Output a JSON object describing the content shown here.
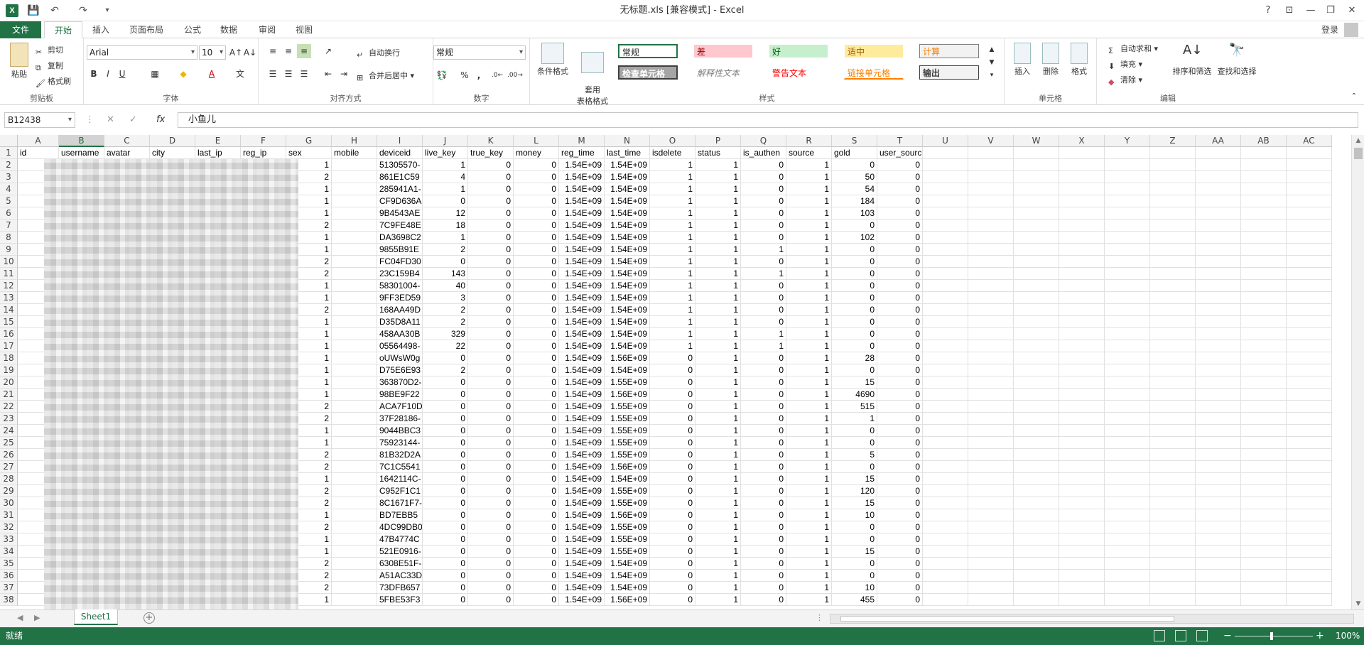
{
  "titlebar": {
    "title": "无标题.xls [兼容模式] - Excel",
    "app_icon": "X",
    "undo": "↶",
    "redo": "↷",
    "save": "💾",
    "help": "?",
    "minimize": "—",
    "restore": "❐",
    "close": "✕",
    "ribbon_toggle": "⊡"
  },
  "tabs": {
    "file": "文件",
    "items": [
      "开始",
      "插入",
      "页面布局",
      "公式",
      "数据",
      "审阅",
      "视图"
    ],
    "login": "登录"
  },
  "ribbon": {
    "clipboard": {
      "label": "剪贴板",
      "paste": "粘贴",
      "cut": "剪切",
      "copy": "复制",
      "format_painter": "格式刷"
    },
    "font": {
      "label": "字体",
      "font_name": "Arial",
      "font_size": "10",
      "bold": "B",
      "italic": "I",
      "underline": "U"
    },
    "alignment": {
      "label": "对齐方式",
      "wrap": "自动换行",
      "merge": "合并后居中"
    },
    "number": {
      "label": "数字",
      "format": "常规",
      "percent": "%",
      "comma": ","
    },
    "styles": {
      "label": "样式",
      "conditional": "条件格式",
      "table": "套用\n表格格式",
      "cells": [
        "常规",
        "差",
        "好",
        "适中",
        "计算",
        "检查单元格",
        "解释性文本",
        "警告文本",
        "链接单元格",
        "输出"
      ]
    },
    "cells": {
      "label": "单元格",
      "insert": "插入",
      "delete": "删除",
      "format": "格式"
    },
    "editing": {
      "label": "编辑",
      "autosum": "自动求和",
      "fill": "填充",
      "clear": "清除",
      "sort": "排序和筛选",
      "find": "查找和选择"
    }
  },
  "formula_bar": {
    "name_box": "B12438",
    "fx": "fx",
    "cancel": "✕",
    "enter": "✓",
    "content": "小鱼儿"
  },
  "columns": [
    "A",
    "B",
    "C",
    "D",
    "E",
    "F",
    "G",
    "H",
    "I",
    "J",
    "K",
    "L",
    "M",
    "N",
    "O",
    "P",
    "Q",
    "R",
    "S",
    "T",
    "U",
    "V",
    "W",
    "X",
    "Y",
    "Z",
    "AA",
    "AB",
    "AC"
  ],
  "header_row": [
    "id",
    "username",
    "avatar",
    "city",
    "last_ip",
    "reg_ip",
    "sex",
    "mobile",
    "deviceid",
    "live_key",
    "true_key",
    "money",
    "reg_time",
    "last_time",
    "isdelete",
    "status",
    "is_authen",
    "source",
    "gold",
    "user_source"
  ],
  "rows": [
    {
      "r": "2",
      "sex": "1",
      "dev": "51305570-",
      "lk": "1",
      "tk": "0",
      "mo": "0",
      "rt": "1.54E+09",
      "lt": "1.54E+09",
      "del": "1",
      "st": "1",
      "au": "0",
      "src": "1",
      "gold": "0",
      "us": "0"
    },
    {
      "r": "3",
      "sex": "2",
      "dev": "861E1C59",
      "lk": "4",
      "tk": "0",
      "mo": "0",
      "rt": "1.54E+09",
      "lt": "1.54E+09",
      "del": "1",
      "st": "1",
      "au": "0",
      "src": "1",
      "gold": "50",
      "us": "0"
    },
    {
      "r": "4",
      "sex": "1",
      "dev": "285941A1-",
      "lk": "1",
      "tk": "0",
      "mo": "0",
      "rt": "1.54E+09",
      "lt": "1.54E+09",
      "del": "1",
      "st": "1",
      "au": "0",
      "src": "1",
      "gold": "54",
      "us": "0"
    },
    {
      "r": "5",
      "sex": "1",
      "dev": "CF9D636A",
      "lk": "0",
      "tk": "0",
      "mo": "0",
      "rt": "1.54E+09",
      "lt": "1.54E+09",
      "del": "1",
      "st": "1",
      "au": "0",
      "src": "1",
      "gold": "184",
      "us": "0"
    },
    {
      "r": "6",
      "sex": "1",
      "dev": "9B4543AE",
      "lk": "12",
      "tk": "0",
      "mo": "0",
      "rt": "1.54E+09",
      "lt": "1.54E+09",
      "del": "1",
      "st": "1",
      "au": "0",
      "src": "1",
      "gold": "103",
      "us": "0"
    },
    {
      "r": "7",
      "sex": "2",
      "dev": "7C9FE48E",
      "lk": "18",
      "tk": "0",
      "mo": "0",
      "rt": "1.54E+09",
      "lt": "1.54E+09",
      "del": "1",
      "st": "1",
      "au": "0",
      "src": "1",
      "gold": "0",
      "us": "0"
    },
    {
      "r": "8",
      "sex": "1",
      "dev": "DA3698C2",
      "lk": "1",
      "tk": "0",
      "mo": "0",
      "rt": "1.54E+09",
      "lt": "1.54E+09",
      "del": "1",
      "st": "1",
      "au": "0",
      "src": "1",
      "gold": "102",
      "us": "0"
    },
    {
      "r": "9",
      "sex": "1",
      "dev": "9855B91E",
      "lk": "2",
      "tk": "0",
      "mo": "0",
      "rt": "1.54E+09",
      "lt": "1.54E+09",
      "del": "1",
      "st": "1",
      "au": "1",
      "src": "1",
      "gold": "0",
      "us": "0"
    },
    {
      "r": "10",
      "sex": "2",
      "dev": "FC04FD30",
      "lk": "0",
      "tk": "0",
      "mo": "0",
      "rt": "1.54E+09",
      "lt": "1.54E+09",
      "del": "1",
      "st": "1",
      "au": "0",
      "src": "1",
      "gold": "0",
      "us": "0"
    },
    {
      "r": "11",
      "sex": "2",
      "dev": "23C159B4",
      "lk": "143",
      "tk": "0",
      "mo": "0",
      "rt": "1.54E+09",
      "lt": "1.54E+09",
      "del": "1",
      "st": "1",
      "au": "1",
      "src": "1",
      "gold": "0",
      "us": "0"
    },
    {
      "r": "12",
      "sex": "1",
      "dev": "58301004-",
      "lk": "40",
      "tk": "0",
      "mo": "0",
      "rt": "1.54E+09",
      "lt": "1.54E+09",
      "del": "1",
      "st": "1",
      "au": "0",
      "src": "1",
      "gold": "0",
      "us": "0"
    },
    {
      "r": "13",
      "sex": "1",
      "dev": "9FF3ED59",
      "lk": "3",
      "tk": "0",
      "mo": "0",
      "rt": "1.54E+09",
      "lt": "1.54E+09",
      "del": "1",
      "st": "1",
      "au": "0",
      "src": "1",
      "gold": "0",
      "us": "0"
    },
    {
      "r": "14",
      "sex": "2",
      "dev": "168AA49D",
      "lk": "2",
      "tk": "0",
      "mo": "0",
      "rt": "1.54E+09",
      "lt": "1.54E+09",
      "del": "1",
      "st": "1",
      "au": "0",
      "src": "1",
      "gold": "0",
      "us": "0"
    },
    {
      "r": "15",
      "sex": "1",
      "dev": "D35D8A11",
      "lk": "2",
      "tk": "0",
      "mo": "0",
      "rt": "1.54E+09",
      "lt": "1.54E+09",
      "del": "1",
      "st": "1",
      "au": "0",
      "src": "1",
      "gold": "0",
      "us": "0"
    },
    {
      "r": "16",
      "sex": "1",
      "dev": "458AA30B",
      "lk": "329",
      "tk": "0",
      "mo": "0",
      "rt": "1.54E+09",
      "lt": "1.54E+09",
      "del": "1",
      "st": "1",
      "au": "1",
      "src": "1",
      "gold": "0",
      "us": "0"
    },
    {
      "r": "17",
      "sex": "1",
      "dev": "05564498-",
      "lk": "22",
      "tk": "0",
      "mo": "0",
      "rt": "1.54E+09",
      "lt": "1.54E+09",
      "del": "1",
      "st": "1",
      "au": "1",
      "src": "1",
      "gold": "0",
      "us": "0"
    },
    {
      "r": "18",
      "sex": "1",
      "dev": "oUWsW0g",
      "lk": "0",
      "tk": "0",
      "mo": "0",
      "rt": "1.54E+09",
      "lt": "1.56E+09",
      "del": "0",
      "st": "1",
      "au": "0",
      "src": "1",
      "gold": "28",
      "us": "0"
    },
    {
      "r": "19",
      "sex": "1",
      "dev": "D75E6E93",
      "lk": "2",
      "tk": "0",
      "mo": "0",
      "rt": "1.54E+09",
      "lt": "1.54E+09",
      "del": "0",
      "st": "1",
      "au": "0",
      "src": "1",
      "gold": "0",
      "us": "0"
    },
    {
      "r": "20",
      "sex": "1",
      "dev": "363870D2-",
      "lk": "0",
      "tk": "0",
      "mo": "0",
      "rt": "1.54E+09",
      "lt": "1.55E+09",
      "del": "0",
      "st": "1",
      "au": "0",
      "src": "1",
      "gold": "15",
      "us": "0"
    },
    {
      "r": "21",
      "sex": "1",
      "dev": "98BE9F22",
      "lk": "0",
      "tk": "0",
      "mo": "0",
      "rt": "1.54E+09",
      "lt": "1.56E+09",
      "del": "0",
      "st": "1",
      "au": "0",
      "src": "1",
      "gold": "4690",
      "us": "0"
    },
    {
      "r": "22",
      "sex": "2",
      "dev": "ACA7F10D",
      "lk": "0",
      "tk": "0",
      "mo": "0",
      "rt": "1.54E+09",
      "lt": "1.55E+09",
      "del": "0",
      "st": "1",
      "au": "0",
      "src": "1",
      "gold": "515",
      "us": "0"
    },
    {
      "r": "23",
      "sex": "2",
      "dev": "37F28186-",
      "lk": "0",
      "tk": "0",
      "mo": "0",
      "rt": "1.54E+09",
      "lt": "1.55E+09",
      "del": "0",
      "st": "1",
      "au": "0",
      "src": "1",
      "gold": "1",
      "us": "0"
    },
    {
      "r": "24",
      "sex": "1",
      "dev": "9044BBC3",
      "lk": "0",
      "tk": "0",
      "mo": "0",
      "rt": "1.54E+09",
      "lt": "1.55E+09",
      "del": "0",
      "st": "1",
      "au": "0",
      "src": "1",
      "gold": "0",
      "us": "0"
    },
    {
      "r": "25",
      "sex": "1",
      "dev": "75923144-",
      "lk": "0",
      "tk": "0",
      "mo": "0",
      "rt": "1.54E+09",
      "lt": "1.55E+09",
      "del": "0",
      "st": "1",
      "au": "0",
      "src": "1",
      "gold": "0",
      "us": "0"
    },
    {
      "r": "26",
      "sex": "2",
      "dev": "81B32D2A",
      "lk": "0",
      "tk": "0",
      "mo": "0",
      "rt": "1.54E+09",
      "lt": "1.55E+09",
      "del": "0",
      "st": "1",
      "au": "0",
      "src": "1",
      "gold": "5",
      "us": "0"
    },
    {
      "r": "27",
      "sex": "2",
      "dev": "7C1C5541",
      "lk": "0",
      "tk": "0",
      "mo": "0",
      "rt": "1.54E+09",
      "lt": "1.56E+09",
      "del": "0",
      "st": "1",
      "au": "0",
      "src": "1",
      "gold": "0",
      "us": "0"
    },
    {
      "r": "28",
      "sex": "1",
      "dev": "1642114C-",
      "lk": "0",
      "tk": "0",
      "mo": "0",
      "rt": "1.54E+09",
      "lt": "1.54E+09",
      "del": "0",
      "st": "1",
      "au": "0",
      "src": "1",
      "gold": "15",
      "us": "0"
    },
    {
      "r": "29",
      "sex": "2",
      "dev": "C952F1C1",
      "lk": "0",
      "tk": "0",
      "mo": "0",
      "rt": "1.54E+09",
      "lt": "1.55E+09",
      "del": "0",
      "st": "1",
      "au": "0",
      "src": "1",
      "gold": "120",
      "us": "0"
    },
    {
      "r": "30",
      "sex": "2",
      "dev": "8C1671F7-",
      "lk": "0",
      "tk": "0",
      "mo": "0",
      "rt": "1.54E+09",
      "lt": "1.55E+09",
      "del": "0",
      "st": "1",
      "au": "0",
      "src": "1",
      "gold": "15",
      "us": "0"
    },
    {
      "r": "31",
      "sex": "1",
      "dev": "BD7EBB5",
      "lk": "0",
      "tk": "0",
      "mo": "0",
      "rt": "1.54E+09",
      "lt": "1.56E+09",
      "del": "0",
      "st": "1",
      "au": "0",
      "src": "1",
      "gold": "10",
      "us": "0"
    },
    {
      "r": "32",
      "sex": "2",
      "dev": "4DC99DB0",
      "lk": "0",
      "tk": "0",
      "mo": "0",
      "rt": "1.54E+09",
      "lt": "1.55E+09",
      "del": "0",
      "st": "1",
      "au": "0",
      "src": "1",
      "gold": "0",
      "us": "0"
    },
    {
      "r": "33",
      "sex": "1",
      "dev": "47B4774C",
      "lk": "0",
      "tk": "0",
      "mo": "0",
      "rt": "1.54E+09",
      "lt": "1.55E+09",
      "del": "0",
      "st": "1",
      "au": "0",
      "src": "1",
      "gold": "0",
      "us": "0"
    },
    {
      "r": "34",
      "sex": "1",
      "dev": "521E0916-",
      "lk": "0",
      "tk": "0",
      "mo": "0",
      "rt": "1.54E+09",
      "lt": "1.55E+09",
      "del": "0",
      "st": "1",
      "au": "0",
      "src": "1",
      "gold": "15",
      "us": "0"
    },
    {
      "r": "35",
      "sex": "2",
      "dev": "6308E51F-",
      "lk": "0",
      "tk": "0",
      "mo": "0",
      "rt": "1.54E+09",
      "lt": "1.54E+09",
      "del": "0",
      "st": "1",
      "au": "0",
      "src": "1",
      "gold": "0",
      "us": "0"
    },
    {
      "r": "36",
      "sex": "2",
      "dev": "A51AC33D",
      "lk": "0",
      "tk": "0",
      "mo": "0",
      "rt": "1.54E+09",
      "lt": "1.54E+09",
      "del": "0",
      "st": "1",
      "au": "0",
      "src": "1",
      "gold": "0",
      "us": "0"
    },
    {
      "r": "37",
      "sex": "2",
      "dev": "73DFB657",
      "lk": "0",
      "tk": "0",
      "mo": "0",
      "rt": "1.54E+09",
      "lt": "1.54E+09",
      "del": "0",
      "st": "1",
      "au": "0",
      "src": "1",
      "gold": "10",
      "us": "0"
    },
    {
      "r": "38",
      "sex": "1",
      "dev": "5FBE53F3",
      "lk": "0",
      "tk": "0",
      "mo": "0",
      "rt": "1.54E+09",
      "lt": "1.56E+09",
      "del": "0",
      "st": "1",
      "au": "0",
      "src": "1",
      "gold": "455",
      "us": "0"
    }
  ],
  "sheetbar": {
    "sheet_name": "Sheet1",
    "add": "+",
    "prev": "◀",
    "next": "▶"
  },
  "status": {
    "ready": "就绪",
    "zoom": "100%",
    "zoom_out": "−",
    "zoom_in": "+"
  },
  "colors": {
    "accent": "#217346"
  }
}
